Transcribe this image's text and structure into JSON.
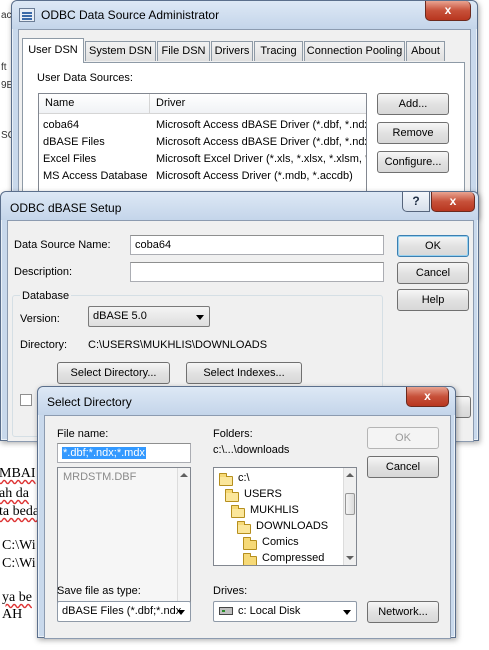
{
  "background": {
    "fragments": [
      "MBAI",
      "ah  da",
      "ta beda",
      "C:\\Wi",
      "C:\\Wi",
      "ya  be",
      "AH"
    ],
    "top_left_fragments": [
      "ac",
      "ft",
      "9E",
      "SC"
    ]
  },
  "odbc_admin": {
    "title": "ODBC Data Source Administrator",
    "tabs": [
      "User DSN",
      "System DSN",
      "File DSN",
      "Drivers",
      "Tracing",
      "Connection Pooling",
      "About"
    ],
    "section_label": "User Data Sources:",
    "columns": [
      "Name",
      "Driver"
    ],
    "rows": [
      {
        "name": "coba64",
        "driver": "Microsoft Access dBASE Driver (*.dbf, *.ndx"
      },
      {
        "name": "dBASE Files",
        "driver": "Microsoft Access dBASE Driver (*.dbf, *.ndx"
      },
      {
        "name": "Excel Files",
        "driver": "Microsoft Excel Driver (*.xls, *.xlsx, *.xlsm, *.x"
      },
      {
        "name": "MS Access Database",
        "driver": "Microsoft Access Driver (*.mdb, *.accdb)"
      }
    ],
    "buttons": {
      "add": "Add...",
      "remove": "Remove",
      "configure": "Configure..."
    },
    "close_glyph": "x"
  },
  "dbase_setup": {
    "title": "ODBC dBASE Setup",
    "help_glyph": "?",
    "data_source_name_label": "Data Source Name:",
    "data_source_name_value": "coba64",
    "description_label": "Description:",
    "description_value": "",
    "group_label": "Database",
    "version_label": "Version:",
    "version_value": "dBASE 5.0",
    "directory_label": "Directory:",
    "directory_value": "C:\\USERS\\MUKHLIS\\DOWNLOADS",
    "buttons": {
      "ok": "OK",
      "cancel": "Cancel",
      "help": "Help",
      "select_directory": "Select Directory...",
      "select_indexes": "Select Indexes..."
    }
  },
  "select_directory": {
    "title": "Select Directory",
    "file_name_label": "File name:",
    "file_name_value": "*.dbf;*.ndx;*.mdx",
    "files": [
      "MRDSTM.DBF"
    ],
    "folders_label": "Folders:",
    "current_path": "c:\\...\\downloads",
    "tree": [
      "c:\\",
      "USERS",
      "MUKHLIS",
      "DOWNLOADS",
      "Comics",
      "Compressed"
    ],
    "save_as_type_label": "Save file as type:",
    "save_as_type_value": "dBASE Files (*.dbf;*.ndx",
    "drives_label": "Drives:",
    "drive_value": "c: Local Disk",
    "buttons": {
      "ok": "OK",
      "cancel": "Cancel",
      "network": "Network..."
    },
    "close_glyph": "x"
  }
}
